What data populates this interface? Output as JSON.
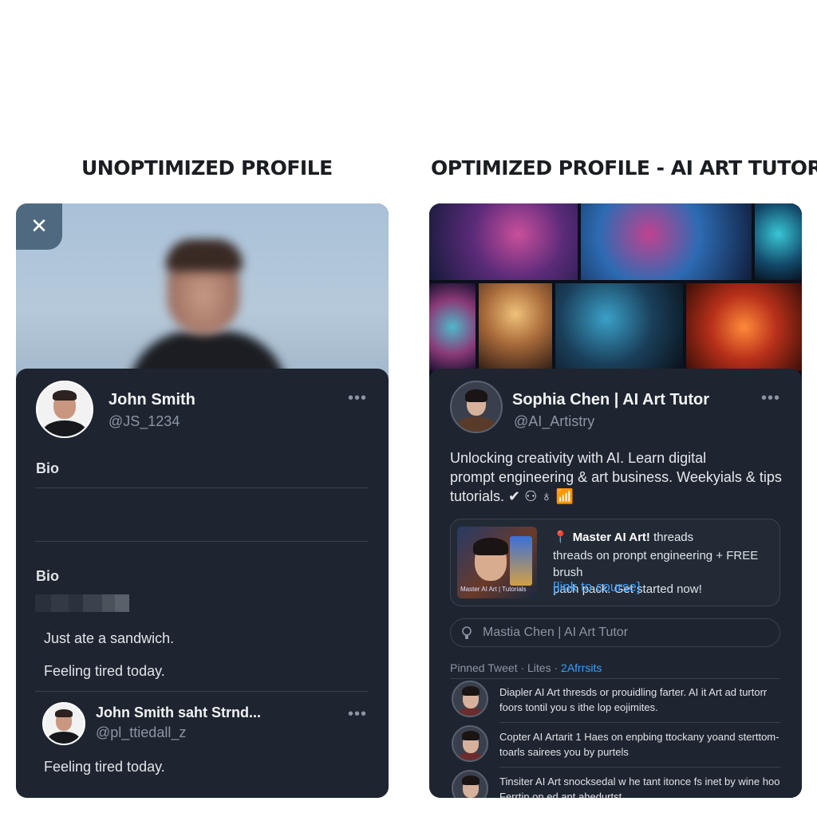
{
  "headings": {
    "left": "UNOPTIMIZED PROFILE",
    "right": "OPTIMIZED PROFILE - AI ART TUTOR"
  },
  "left_profile": {
    "close_icon_glyph": "✕",
    "name": "John Smith",
    "handle": "@JS_1234",
    "more": "•••",
    "bio_label_1": "Bio",
    "bio_label_2": "Bio",
    "posts": [
      "Just ate a sandwich.",
      "Feeling tired today."
    ],
    "reply": {
      "name": "John Smith saht Strnd...",
      "handle": "@pl_ttiedall_z",
      "more": "•••",
      "text": "Feeling tired today."
    }
  },
  "right_profile": {
    "name": "Sophia Chen | AI Art Tutor",
    "handle": "@AI_Artistry",
    "more": "•••",
    "bio_lines": [
      "Unlocking creativity with AI. Learn digital",
      "prompt engineering & art business. Weekyials & tips",
      "tutorials. ✔ ⚇ ♁ 📶"
    ],
    "promo": {
      "thumb_label": "Master AI Art | Tutorials",
      "title_bold": "Master AI Art!",
      "title_rest": " threads",
      "body_lines": [
        "threads on pronpt engineering + FREE brush",
        "pach pack. Get started now!"
      ],
      "link": "[link to course]"
    },
    "search_placeholder": "Mastia Chen | AI Art Tutor",
    "pinned": {
      "label": "Pinned Tweet · Lites ·",
      "accent": "2Afrrsits"
    },
    "tweets": [
      [
        "Diapler AI Art thresds or prouidling farter. AI it Art ad turtorr",
        "foors tontil you s ithe lop eojimites."
      ],
      [
        "Copter AI Artarit 1 Haes on enpbing ttockany yoand sterttom-",
        "toarls sairees you by purtels"
      ],
      [
        "Tinsiter AI Art snocksedal w he tant itonce fs inet by wine hoo",
        "Ferrtin on ed ant ahedurtst."
      ]
    ]
  },
  "colors": {
    "card_bg": "#1e2530",
    "accent_link": "#3aa0ff",
    "pin_red": "#e8465a",
    "muted_text": "#8b95a3"
  },
  "icons": [
    "close-icon",
    "more-icon",
    "pin-icon",
    "search-icon"
  ]
}
